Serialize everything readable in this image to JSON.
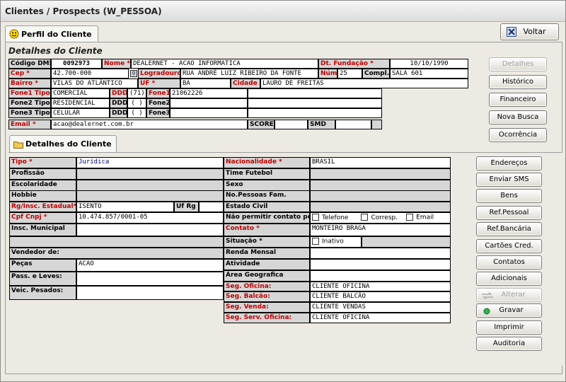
{
  "window": {
    "title": "Clientes / Prospects (W_PESSOA)"
  },
  "tabs": {
    "top": "Perfil do Cliente",
    "bottom": "Detalhes do Cliente"
  },
  "header_section": {
    "title": "Detalhes do Cliente"
  },
  "top_buttons": {
    "voltar": "Voltar"
  },
  "side_buttons": [
    "Detalhes",
    "Histórico",
    "Financeiro",
    "Nova Busca",
    "Ocorrência"
  ],
  "top_form": {
    "codigo_dms_label": "Código DMS",
    "codigo_dms_value": "0092973",
    "nome_label": "Nome *",
    "nome_value": "DEALERNET - ACAO INFORMATICA",
    "dt_fundacao_label": "Dt. Fundação *",
    "dt_fundacao_value": "10/10/1990",
    "cep_label": "Cep *",
    "cep_value": "42.700-000",
    "logradouro_label": "Logradouro*",
    "logradouro_value": "RUA ANDRÉ LUIZ RIBEIRO DA FONTE",
    "num_label": "Núm*",
    "num_value": "25",
    "compl_label": "Compl.",
    "compl_value": "SALA 601",
    "bairro_label": "Bairro *",
    "bairro_value": "VILAS DO ATLÂNTICO",
    "uf_label": "UF *",
    "uf_value": "BA",
    "cidade_label": "Cidade *",
    "cidade_value": "LAURO DE FREITAS",
    "fone1_tipo_label": "Fone1 Tipo*",
    "fone1_tipo_value": "COMERCIAL",
    "ddd_label": "DDD",
    "fone1_ddd": "(71)",
    "fone1_label": "Fone1",
    "fone1_value": "21062226",
    "fone2_tipo_label": "Fone2 Tipo",
    "fone2_tipo_value": "RESIDENCIAL",
    "fone2_ddd": "(  )",
    "fone2_label": "Fone2",
    "fone3_tipo_label": "Fone3 Tipo",
    "fone3_tipo_value": "CELULAR",
    "fone3_ddd": "(  )",
    "fone3_label": "Fone3",
    "email_label": "Email *",
    "email_value": "acao@dealernet.com.br",
    "score_label": "SCORE",
    "smd_label": "SMD"
  },
  "detail_left": {
    "tipo_label": "Tipo *",
    "tipo_value": "Jurídica",
    "profissao_label": "Profissão",
    "escolaridade_label": "Escolaridade",
    "hobbie_label": "Hobbie",
    "rg_label": "Rg/Insc. Estadual*",
    "rg_value": "ISENTO",
    "ufrg_label": "Uf Rg",
    "cpf_label": "Cpf Cnpj *",
    "cpf_value": "10.474.857/0001-05",
    "insc_mun_label": "Insc. Municipal",
    "vendedor_label": "Vendedor de:",
    "pecas_label": "Peças",
    "pecas_value": "ACAO",
    "pass_label": "Pass. e Leves:",
    "veic_label": "Veic. Pesados:"
  },
  "detail_right": {
    "nacionalidade_label": "Nacionalidade *",
    "nacionalidade_value": "BRASIL",
    "time_label": "Time Futebol",
    "sexo_label": "Sexo",
    "nopessoas_label": "No.Pessoas Fam.",
    "estado_civil_label": "Estado Civil",
    "nao_permitir_label": "Não permitir contato por",
    "telefone_opt": "Telefone",
    "corresp_opt": "Corresp.",
    "email_opt": "Email",
    "contato_label": "Contato *",
    "contato_value": "MONTEIRO BRAGA",
    "situacao_label": "Situação *",
    "situacao_opt": "Inativo",
    "renda_label": "Renda Mensal",
    "atividade_label": "Atividade",
    "area_label": "Área Geografica",
    "seg_oficina_label": "Seg. Oficina:",
    "seg_oficina_value": "CLIENTE OFICINA",
    "seg_balcao_label": "Seg. Balcão:",
    "seg_balcao_value": "CLIENTE BALCÃO",
    "seg_venda_label": "Seg. Venda:",
    "seg_venda_value": "CLIENTE VENDAS",
    "seg_serv_label": "Seg. Serv. Oficina:",
    "seg_serv_value": "CLIENTE OFICINA"
  },
  "right_buttons": [
    "Endereços",
    "Enviar SMS",
    "Bens",
    "Ref.Pessoal",
    "Ref.Bancária",
    "Cartões Cred.",
    "Contatos",
    "Adicionais",
    "Alterar",
    "Gravar",
    "Imprimir",
    "Auditoria"
  ],
  "colors": {
    "required_label": "#c00000",
    "label_bg": "#d6d6d6"
  }
}
